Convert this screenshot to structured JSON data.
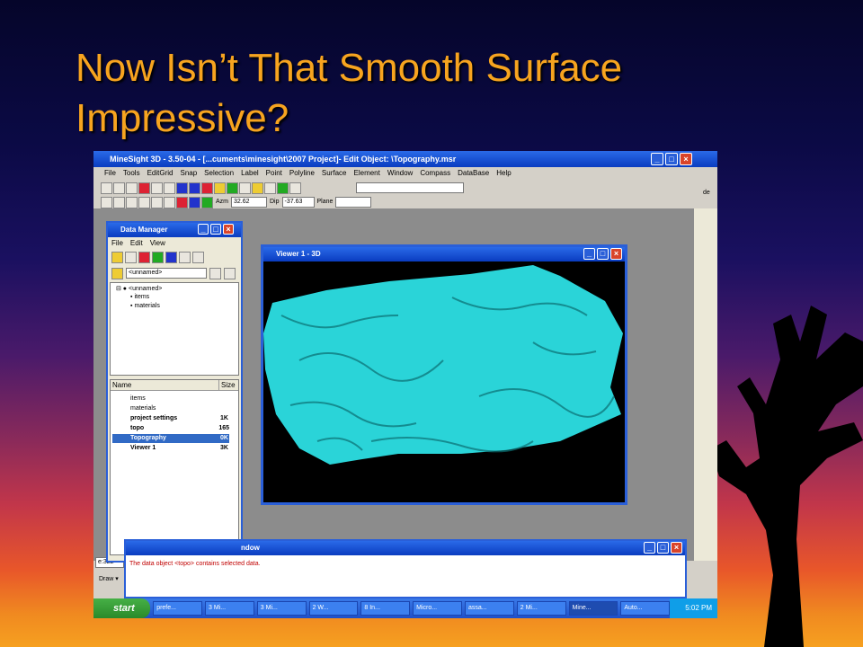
{
  "slide": {
    "title_line1": "Now Isn’t That Smooth Surface",
    "title_line2": "Impressive?"
  },
  "app": {
    "title": "MineSight 3D  - 3.50-04 - [...cuments\\minesight\\2007 Project]- Edit Object: \\Topography.msr",
    "menu": [
      "File",
      "Tools",
      "EditGrid",
      "Snap",
      "Selection",
      "Label",
      "Point",
      "Polyline",
      "Surface",
      "Element",
      "Window",
      "Compass",
      "DataBase",
      "Help"
    ],
    "azm_label": "Azm",
    "azm_value": "32.62",
    "dip_label": "Dip",
    "dip_value": "-37.63",
    "plane_label": "Plane",
    "left_field": "e:322",
    "draw_label": "Draw ▾",
    "right_edge_text": "de"
  },
  "data_manager": {
    "title": "Data Manager",
    "menu": [
      "File",
      "Edit",
      "View"
    ],
    "path_value": "<unnamed>",
    "tree": {
      "root": "<unnamed>",
      "children": [
        "items",
        "materials"
      ]
    },
    "list_headers": [
      "Name",
      "Size"
    ],
    "list_rows": [
      {
        "name": "items",
        "size": ""
      },
      {
        "name": "materials",
        "size": ""
      },
      {
        "name": "project settings",
        "size": "1K"
      },
      {
        "name": "topo",
        "size": "165"
      },
      {
        "name": "Topography",
        "size": "0K",
        "selected": true
      },
      {
        "name": "Viewer 1",
        "size": "3K"
      }
    ]
  },
  "viewer": {
    "title": "Viewer 1 - 3D",
    "surface_color": "#2ad4d8"
  },
  "message_window": {
    "title_fragment": "ndow",
    "message": "The data object <topo> contains selected data."
  },
  "taskbar": {
    "start_label": "start",
    "tasks": [
      "prefe...",
      "3 Mi...",
      "3 Mi...",
      "2 W...",
      "8 In...",
      "Micro...",
      "assa...",
      "2 Mi...",
      "Mine...",
      "Auto..."
    ],
    "clock": "5:02 PM"
  }
}
